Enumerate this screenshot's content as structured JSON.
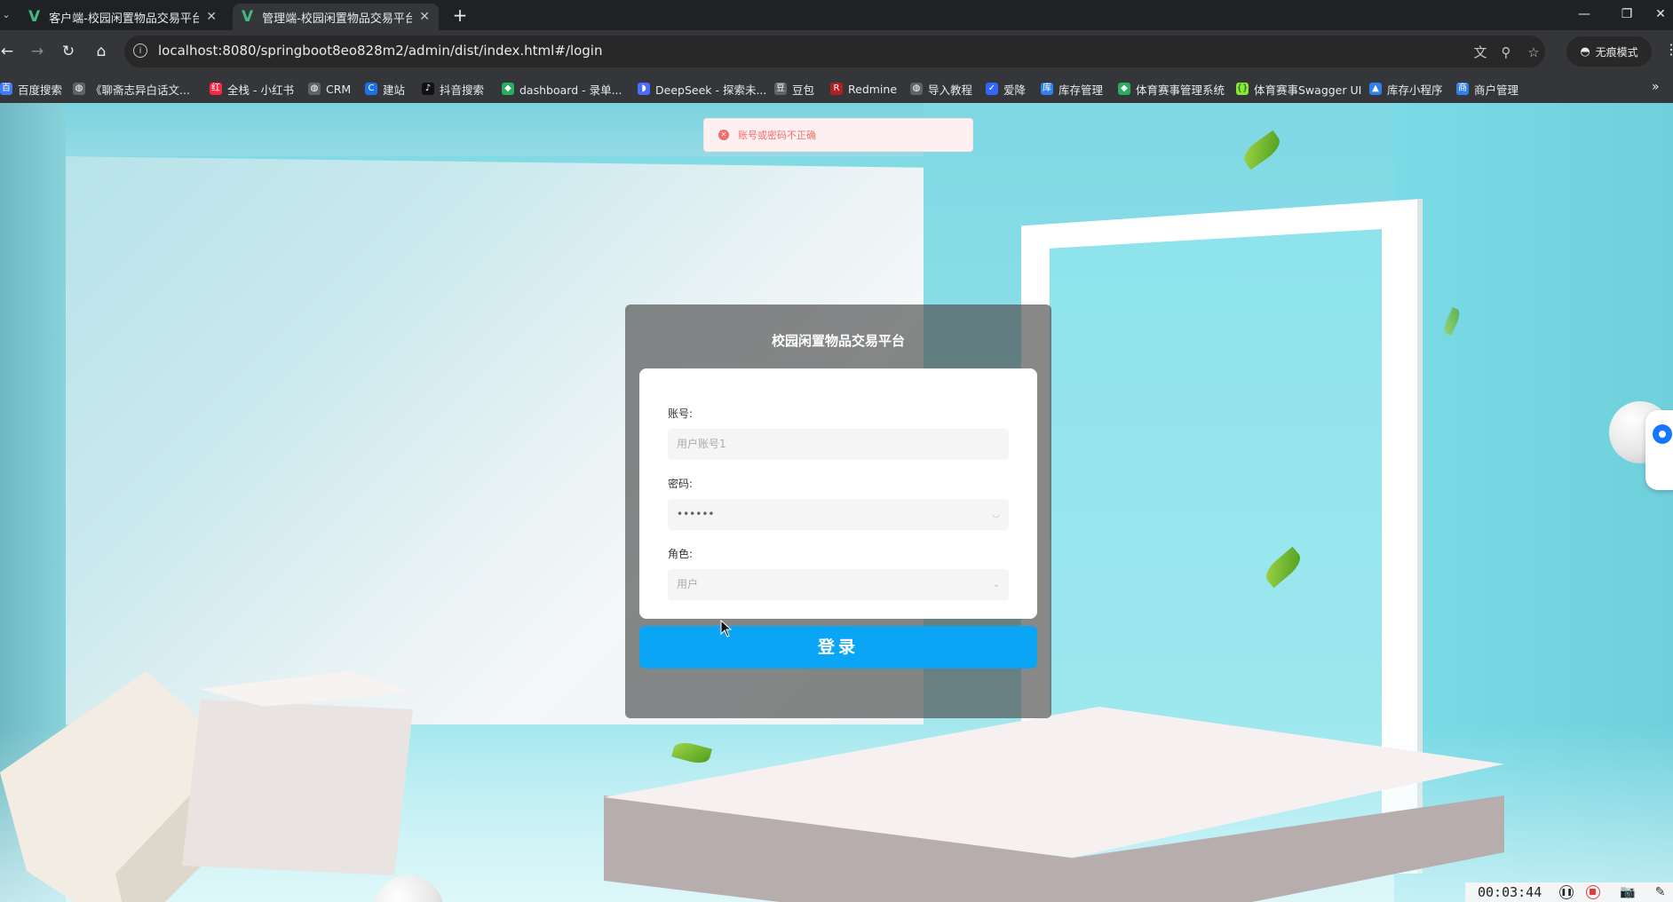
{
  "browser": {
    "tabs": [
      {
        "title": "客户端-校园闲置物品交易平台",
        "active": false
      },
      {
        "title": "管理端-校园闲置物品交易平台",
        "active": true
      }
    ],
    "url": "localhost:8080/springboot8eo828m2/admin/dist/index.html#/login",
    "incognito_label": "无痕模式",
    "bookmarks": [
      {
        "label": "百度搜索",
        "color": "#3b7bfd",
        "icon": "baidu-icon"
      },
      {
        "label": "《聊斋志异白话文...",
        "color": "#5f6368",
        "icon": "globe-icon"
      },
      {
        "label": "全栈 - 小红书",
        "color": "#ff2442",
        "icon": "xiaohongshu-icon"
      },
      {
        "label": "CRM",
        "color": "#5f6368",
        "icon": "globe-icon"
      },
      {
        "label": "建站",
        "color": "#1a73e8",
        "icon": "site-icon"
      },
      {
        "label": "抖音搜索",
        "color": "#111111",
        "icon": "douyin-icon"
      },
      {
        "label": "dashboard - 录单...",
        "color": "#27ae60",
        "icon": "dashboard-icon"
      },
      {
        "label": "DeepSeek - 探索未...",
        "color": "#4d6bfe",
        "icon": "deepseek-icon"
      },
      {
        "label": "豆包",
        "color": "#5f6368",
        "icon": "doubao-icon"
      },
      {
        "label": "Redmine",
        "color": "#b32024",
        "icon": "redmine-icon"
      },
      {
        "label": "导入教程",
        "color": "#5f6368",
        "icon": "globe-icon"
      },
      {
        "label": "爱降",
        "color": "#3366ff",
        "icon": "shield-icon"
      },
      {
        "label": "库存管理",
        "color": "#2f80ed",
        "icon": "app-icon"
      },
      {
        "label": "体育赛事管理系统",
        "color": "#27ae60",
        "icon": "dashboard-icon"
      },
      {
        "label": "体育赛事Swagger UI",
        "color": "#85ea2d",
        "icon": "swagger-icon"
      },
      {
        "label": "库存小程序",
        "color": "#2f80ed",
        "icon": "mini-app-icon"
      },
      {
        "label": "商户管理",
        "color": "#2f80ed",
        "icon": "app-icon"
      }
    ]
  },
  "message": {
    "text": "账号或密码不正确",
    "type": "error"
  },
  "login": {
    "title": "校园闲置物品交易平台",
    "account_label": "账号:",
    "account_placeholder": "用户账号1",
    "password_label": "密码:",
    "password_value": "••••••",
    "role_label": "角色:",
    "role_value": "用户",
    "submit_label": "登录"
  },
  "recorder": {
    "time": "00:03:44"
  },
  "colors": {
    "accent": "#0aa6f5",
    "error": "#f56c6c"
  }
}
